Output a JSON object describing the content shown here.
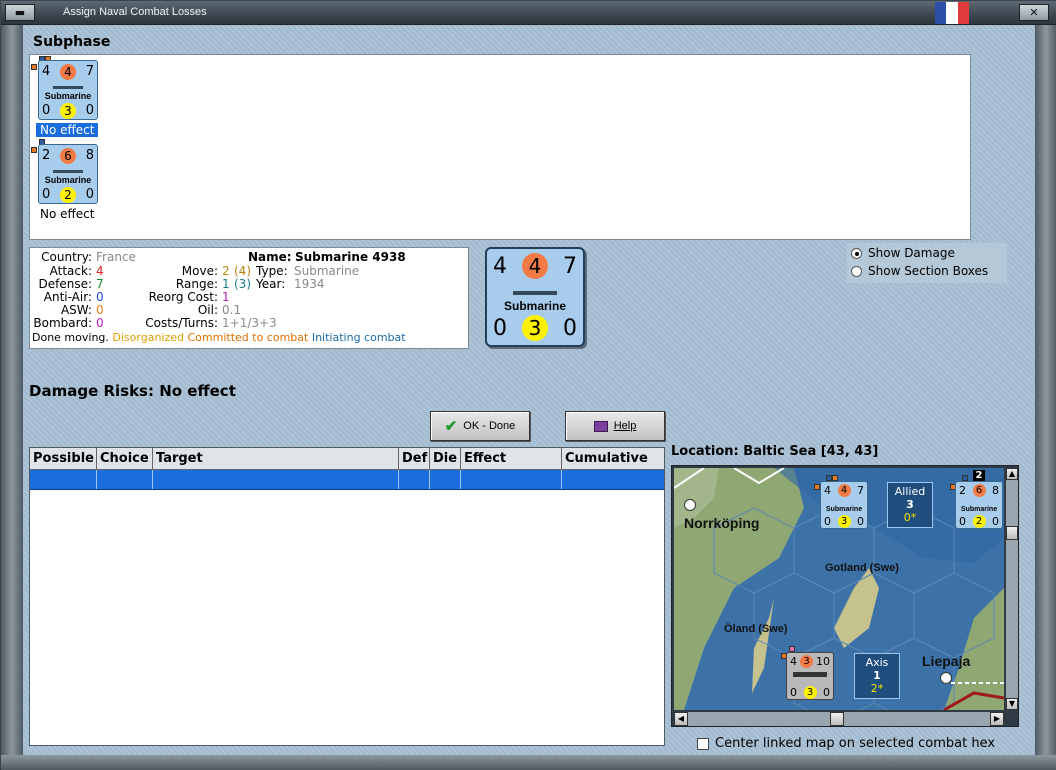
{
  "window": {
    "title": "Assign Naval Combat Losses",
    "close_icon": "close-icon",
    "flag_colors": [
      "#2a4fa6",
      "#ffffff",
      "#e03a3a"
    ]
  },
  "subphase": {
    "heading": "Subphase",
    "units": [
      {
        "attack": "4",
        "mid": "4",
        "defense": "7",
        "type": "Submarine",
        "b1": "0",
        "b2": "3",
        "b3": "0",
        "status": "No effect",
        "selected": true
      },
      {
        "attack": "2",
        "mid": "6",
        "defense": "8",
        "type": "Submarine",
        "b1": "0",
        "b2": "2",
        "b3": "0",
        "status": "No effect",
        "selected": false
      }
    ]
  },
  "info": {
    "country_label": "Country:",
    "country": "France",
    "attack_label": "Attack:",
    "attack": "4",
    "defense_label": "Defense:",
    "defense": "7",
    "antiair_label": "Anti-Air:",
    "antiair": "0",
    "asw_label": "ASW:",
    "asw": "0",
    "bombard_label": "Bombard:",
    "bombard": "0",
    "name_label": "Name:",
    "name": "Submarine 4938",
    "move_label": "Move:",
    "move_a": "2",
    "move_b": "(4)",
    "type_label": "Type:",
    "type": "Submarine",
    "range_label": "Range:",
    "range_a": "1",
    "range_b": "(3)",
    "year_label": "Year:",
    "year": "1934",
    "reorg_label": "Reorg Cost:",
    "reorg": "1",
    "oil_label": "Oil:",
    "oil": "0.1",
    "costs_label": "Costs/Turns:",
    "costs": "1+1/3+3",
    "status_done": "Done moving.",
    "status_disorganized": "Disorganized",
    "status_committed": "Committed to combat",
    "status_initiating": "Initiating combat"
  },
  "big_counter": {
    "top_left": "4",
    "top_mid": "4",
    "top_right": "7",
    "type": "Submarine",
    "bot_left": "0",
    "bot_mid": "3",
    "bot_right": "0"
  },
  "options": {
    "show_damage": "Show Damage",
    "show_section_boxes": "Show Section Boxes",
    "selected": "show_damage"
  },
  "damage": {
    "label": "Damage Risks:",
    "value": "No effect"
  },
  "buttons": {
    "ok": "OK - Done",
    "help": "Help"
  },
  "table": {
    "columns": [
      "Possible",
      "Choice",
      "Target",
      "Def",
      "Die",
      "Effect",
      "Cumulative"
    ],
    "rows": [
      [
        "",
        "",
        "",
        "",
        "",
        "",
        ""
      ]
    ]
  },
  "location": {
    "label": "Location:",
    "value": "Baltic Sea [43, 43]"
  },
  "map": {
    "places": [
      "Norrköping",
      "Gotland (Swe)",
      "Öland (Swe)",
      "Liepaja"
    ],
    "allied_box": {
      "side": "Allied",
      "count": "3",
      "sub": "0*"
    },
    "axis_box": {
      "side": "Axis",
      "count": "1",
      "sub": "2*"
    },
    "counter_a": {
      "top": [
        "4",
        "4",
        "7"
      ],
      "type": "Submarine",
      "bottom": [
        "0",
        "3",
        "0"
      ]
    },
    "counter_b": {
      "top": [
        "2",
        "6",
        "8"
      ],
      "type": "Submarine",
      "bottom": [
        "0",
        "2",
        "0"
      ],
      "badge": "2"
    },
    "counter_c": {
      "top": [
        "4",
        "3",
        "10"
      ],
      "bottom": [
        "0",
        "3",
        "0"
      ]
    }
  },
  "center_map": {
    "label": "Center linked map on selected combat hex",
    "checked": false
  }
}
